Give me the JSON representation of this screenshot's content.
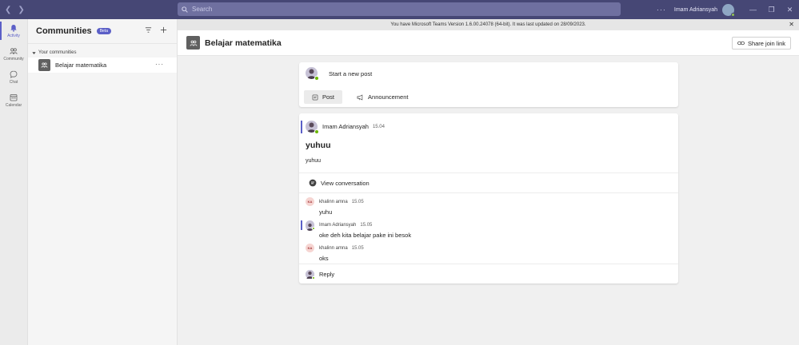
{
  "titlebar": {
    "search_placeholder": "Search",
    "user_name": "Imam Adriansyah",
    "more": "···"
  },
  "rail": {
    "items": [
      {
        "label": "Activity",
        "icon": "bell-icon",
        "active": true
      },
      {
        "label": "Community",
        "icon": "community-icon",
        "active": false
      },
      {
        "label": "Chat",
        "icon": "chat-icon",
        "active": false
      },
      {
        "label": "Calendar",
        "icon": "calendar-icon",
        "active": false
      }
    ]
  },
  "panel": {
    "title": "Communities",
    "badge": "Beta",
    "group_label": "Your communities",
    "community_name": "Belajar matematika",
    "more": "···"
  },
  "banner": {
    "text": "You have Microsoft Teams Version 1.6.00.24078 (64-bit). It was last updated on 28/09/2023."
  },
  "header": {
    "title": "Belajar matematika",
    "share_label": "Share join link"
  },
  "compose": {
    "start_post": "Start a new post",
    "tab_post": "Post",
    "tab_announcement": "Announcement"
  },
  "post": {
    "author": "Imam Adriansyah",
    "time": "15.04",
    "title": "yuhuu",
    "body": "yuhuu",
    "view_conversation": "View conversation",
    "replies": [
      {
        "initials": "KA",
        "author": "khalinn amna",
        "time": "15.05",
        "text": "yuhu"
      },
      {
        "initials": "",
        "author": "Imam Adriansyah",
        "time": "15.05",
        "text": "oke deh kita belajar pake ini besok"
      },
      {
        "initials": "KA",
        "author": "khalinn amna",
        "time": "15.05",
        "text": "oks"
      }
    ],
    "reply_label": "Reply"
  },
  "colors": {
    "titlebar": "#464775",
    "accent": "#5b5fc7",
    "presence": "#6bb700"
  }
}
